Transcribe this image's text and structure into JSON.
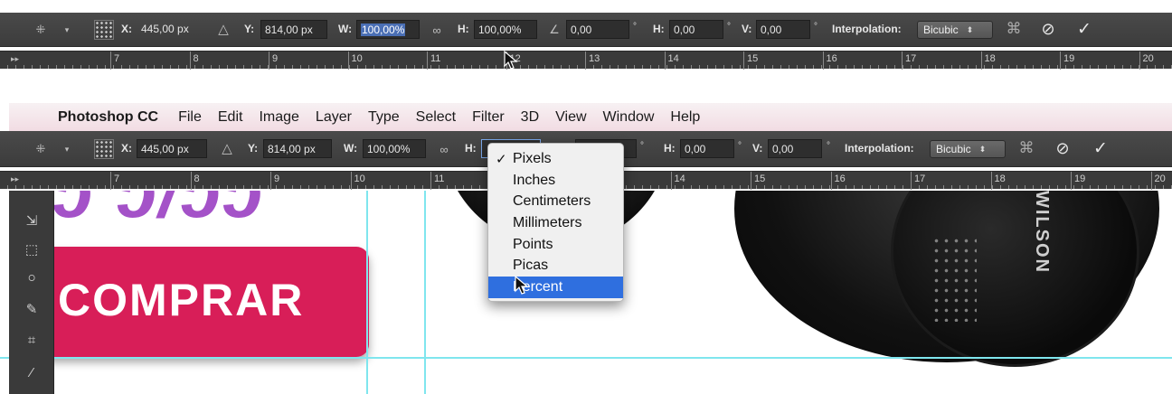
{
  "options_bar": {
    "x_label": "X:",
    "x_value": "445,00 px",
    "y_label": "Y:",
    "y_value": "814,00 px",
    "w_label": "W:",
    "w_value": "100,00%",
    "h_label": "H:",
    "h_value": "100,00%",
    "angle_value": "0,00",
    "hskew_label": "H:",
    "hskew_value": "0,00",
    "vskew_label": "V:",
    "vskew_value": "0,00",
    "interpolation_label": "Interpolation:",
    "interpolation_value": "Bicubic",
    "degree_symbol": "°"
  },
  "ruler": {
    "numbers": [
      "7",
      "8",
      "9",
      "10",
      "11",
      "12",
      "13",
      "14",
      "15",
      "16",
      "17",
      "18",
      "19",
      "20"
    ]
  },
  "menubar": {
    "app_name": "Photoshop CC",
    "items": [
      "File",
      "Edit",
      "Image",
      "Layer",
      "Type",
      "Select",
      "Filter",
      "3D",
      "View",
      "Window",
      "Help"
    ]
  },
  "unit_menu": {
    "items": [
      "Pixels",
      "Inches",
      "Centimeters",
      "Millimeters",
      "Points",
      "Picas",
      "Percent"
    ],
    "checked": "Pixels",
    "highlighted": "Percent",
    "check_mark": "✓"
  },
  "canvas": {
    "button_text": "COMPRAR",
    "headphone_brand": "WILSON"
  },
  "colors": {
    "button": "#d81e58",
    "guide": "#7fe6ee",
    "menu_highlight": "#2f6fdf",
    "accent_purple": "#a452c8"
  },
  "icons": [
    "move-tool-icon",
    "reference-grid-icon",
    "delta-icon",
    "link-icon",
    "angle-icon",
    "warp-icon",
    "cancel-icon",
    "commit-check-icon",
    "apple-icon"
  ]
}
